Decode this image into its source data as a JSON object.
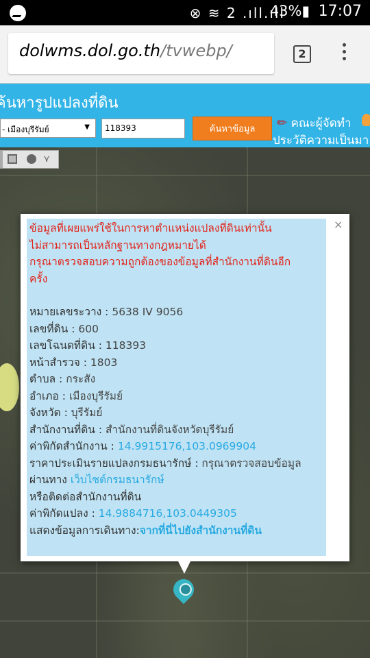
{
  "status_bar": {
    "icons": "⊗  ≋ 2 .ıll.ıll",
    "battery": "43%▮",
    "time": "17:07"
  },
  "browser": {
    "url_host": "dolwms.dol.go.th",
    "url_path": "/tvwebp/",
    "tab_count": "2"
  },
  "header": {
    "title": "ค้นหารูปแปลงที่ดิน",
    "province_selected": "- เมืองบุรีรัมย์",
    "deed_number": "118393",
    "search_label": "ค้นหาข้อมูล",
    "team_label": "คณะผู้จัดทำ",
    "history_label": "ประวัติความเป็นมา"
  },
  "popup": {
    "warning_lines": [
      "ข้อมูลที่เผยแพร่ใช้ในการหาตำแหน่งแปลงที่ดินเท่านั้น",
      "ไม่สามารถเป็นหลักฐานทางกฎหมายได้",
      "กรุณาตรวจสอบความถูกต้องของข้อมูลที่สำนักงานที่ดินอีก",
      "ครั้ง"
    ],
    "close": "×",
    "fields": [
      {
        "label": "หมายเลขระวาง : ",
        "value": "5638 IV 9056"
      },
      {
        "label": "เลขที่ดิน : ",
        "value": "600"
      },
      {
        "label": "เลขโฉนดที่ดิน : ",
        "value": "118393"
      },
      {
        "label": "หน้าสำรวจ : ",
        "value": "1803"
      },
      {
        "label": "ตำบล : ",
        "value": "กระสัง"
      },
      {
        "label": "อำเภอ : ",
        "value": "เมืองบุรีรัมย์"
      },
      {
        "label": "จังหวัด : ",
        "value": "บุรีรัมย์"
      },
      {
        "label": "สำนักงานที่ดิน : ",
        "value": "สำนักงานที่ดินจังหวัดบุรีรัมย์"
      }
    ],
    "office_coord_label": "ค่าพิกัดสำนักงาน : ",
    "office_coord_value": "14.9915176,103.0969904",
    "price_label": "ราคาประเมินรายแปลงกรมธนารักษ์ : ",
    "price_value": "กรุณาตรวจสอบข้อมูล",
    "via_label": "ผ่านทาง ",
    "via_link": "เว็บไซต์กรมธนารักษ์",
    "contact_text": "หรือติดต่อสำนักงานที่ดิน",
    "parcel_coord_label": "ค่าพิกัดแปลง : ",
    "parcel_coord_value": "14.9884716,103.0449305",
    "route_label": "แสดงข้อมูลการเดินทาง:",
    "route_link": "จากที่นี่ไปยังสำนักงานที่ดิน"
  },
  "colors": {
    "header_blue": "#33b4e6",
    "search_orange": "#f07e1f",
    "warning_red": "#e2231a",
    "link_blue": "#27a9e1",
    "popup_bg": "#bfe3f4",
    "pin_teal": "#36b6c4"
  }
}
